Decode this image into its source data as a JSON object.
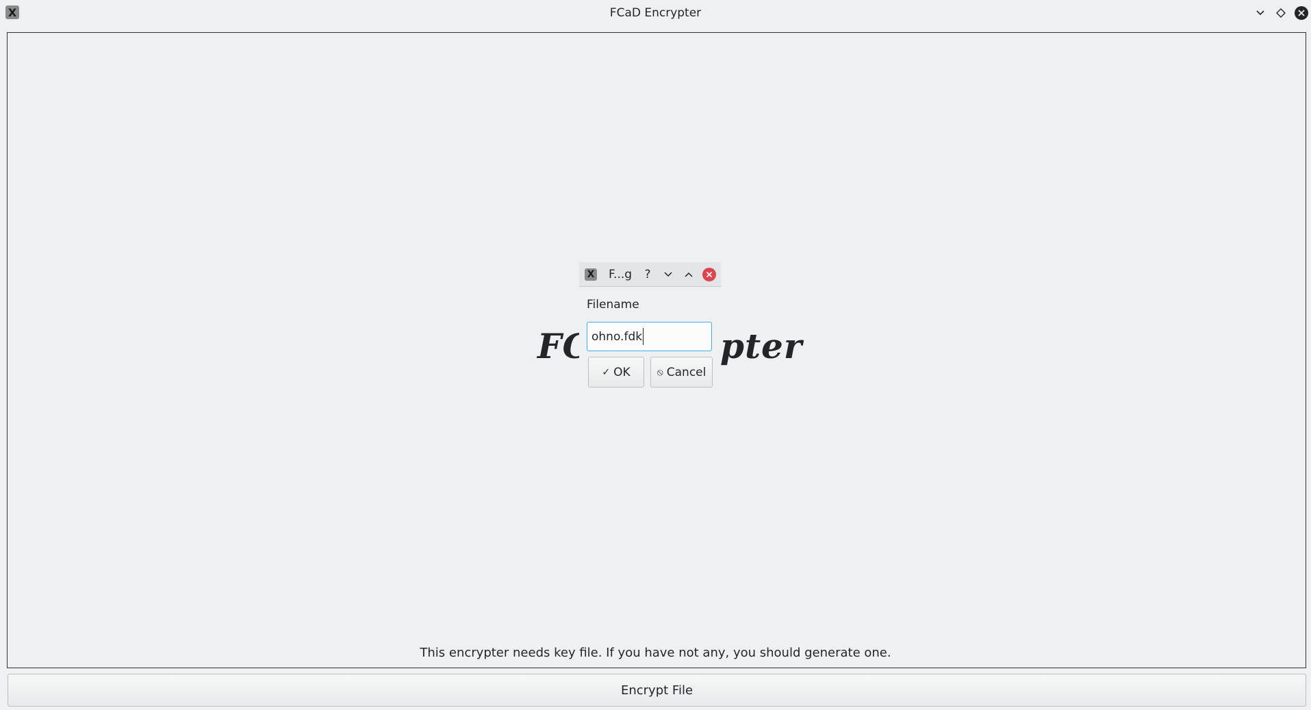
{
  "window": {
    "title": "FCaD Encrypter",
    "app_icon_glyph": "X",
    "controls": [
      "minimize-icon",
      "maximize-icon",
      "close-icon"
    ]
  },
  "main": {
    "logo_left": "FC",
    "logo_right": "pter",
    "status_text": "This encrypter needs key file. If you have not any, you should generate one.",
    "encrypt_button_label": "Encrypt File"
  },
  "dialog": {
    "title": "F...g",
    "app_icon_glyph": "X",
    "help_glyph": "?",
    "filename_label": "Filename",
    "filename_value": "ohno.fdk",
    "ok_label": "OK",
    "ok_icon": "✓",
    "cancel_label": "Cancel",
    "cancel_icon": "⦸"
  },
  "colors": {
    "background": "#eff0f1",
    "accent": "#3daee9",
    "close_red": "#da4453"
  }
}
